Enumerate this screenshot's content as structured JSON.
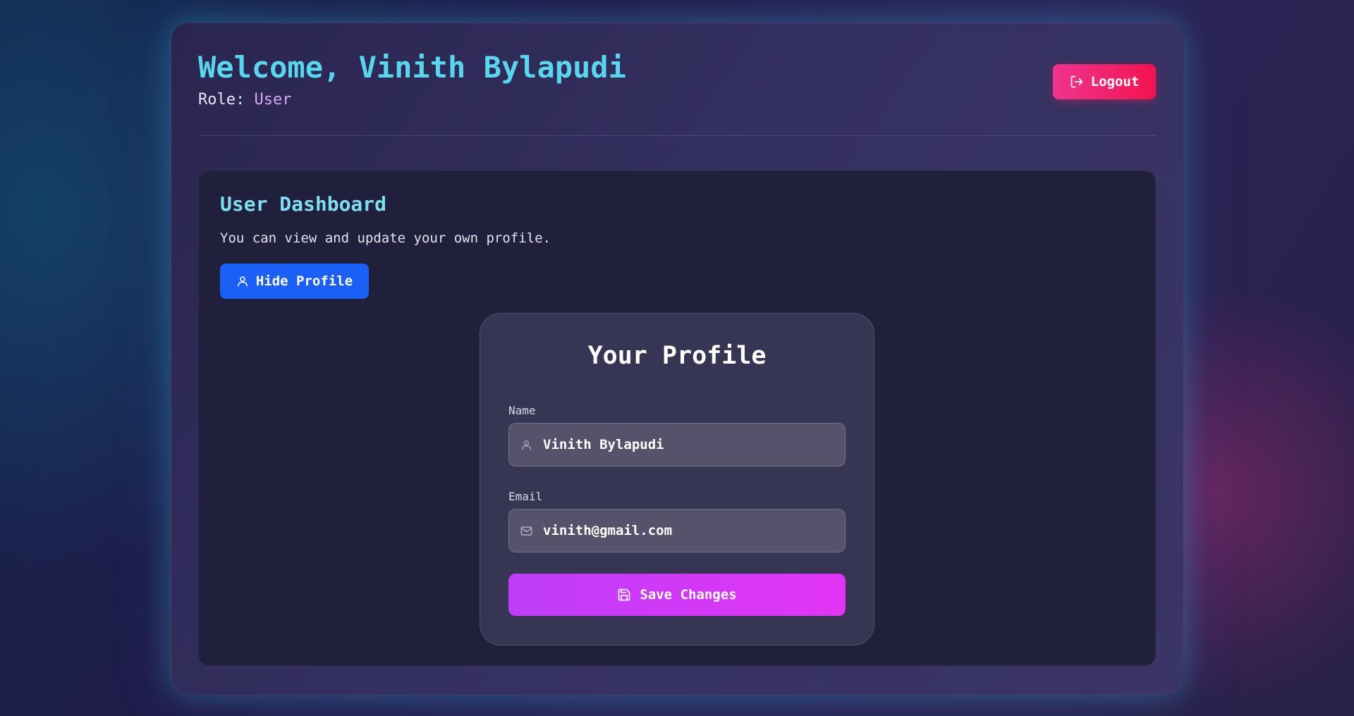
{
  "header": {
    "welcome_prefix": "Welcome, ",
    "user_name": "Vinith Bylapudi",
    "role_label": "Role: ",
    "role_value": "User",
    "logout_label": "Logout"
  },
  "dashboard": {
    "title": "User Dashboard",
    "description": "You can view and update your own profile.",
    "toggle_profile_label": "Hide Profile"
  },
  "profile": {
    "title": "Your Profile",
    "name_label": "Name",
    "name_value": "Vinith Bylapudi",
    "email_label": "Email",
    "email_value": "vinith@gmail.com",
    "save_label": "Save Changes"
  },
  "icons": {
    "logout": "logout-icon",
    "hide_profile": "user-icon",
    "name_field": "user-icon",
    "email_field": "mail-icon",
    "save": "save-icon"
  },
  "colors": {
    "welcome_text": "#58d6ee",
    "role_value": "#d7a6f5",
    "logout_button": "#f2134f",
    "hide_profile_button": "#1a5ff6",
    "save_button": "#d238f6"
  }
}
